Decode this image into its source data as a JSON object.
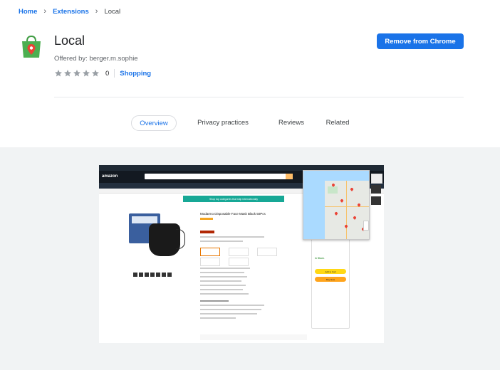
{
  "breadcrumb": {
    "home": "Home",
    "extensions": "Extensions",
    "current": "Local"
  },
  "extension": {
    "name": "Local",
    "offered_by": "Offered by: berger.m.sophie",
    "rating_count": "0",
    "rating_stars": 0,
    "category": "Shopping",
    "remove_button": "Remove from Chrome"
  },
  "tabs": [
    {
      "label": "Overview",
      "active": true
    },
    {
      "label": "Privacy practices",
      "active": false
    },
    {
      "label": "Reviews",
      "active": false
    },
    {
      "label": "Related",
      "active": false
    }
  ],
  "screenshot": {
    "site_logo": "amazon",
    "banner": "Shop top categories that ship internationally",
    "product_title": "Modarmo Disposable Face Mask Black 50Pcs",
    "add_to_cart": "Add to Cart",
    "buy_now": "Buy Now",
    "in_stock": "In Stock."
  },
  "colors": {
    "accent": "#1a73e8",
    "logo_green": "#4caf50",
    "pin_red": "#ea4335"
  }
}
